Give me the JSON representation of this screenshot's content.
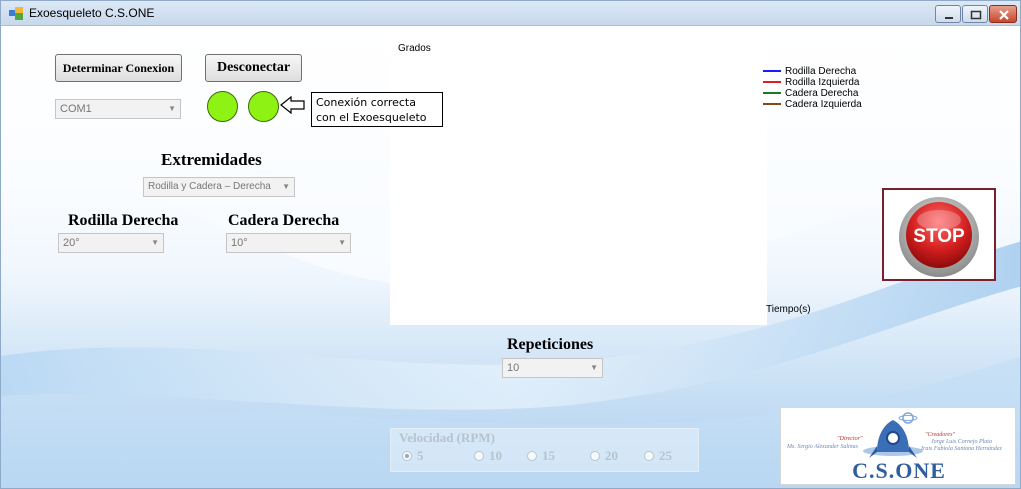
{
  "window": {
    "title": "Exoesqueleto  C.S.ONE"
  },
  "connection": {
    "determine_label": "Determinar Conexion",
    "disconnect_label": "Desconectar",
    "port_value": "COM1",
    "status_message": "Conexión correcta con el Exoesqueleto"
  },
  "extremities": {
    "title": "Extremidades",
    "selected": "Rodilla y Cadera – Derecha"
  },
  "knee": {
    "title": "Rodilla Derecha",
    "value": "20°"
  },
  "hip": {
    "title": "Cadera Derecha",
    "value": "10°"
  },
  "chart": {
    "ylabel": "Grados",
    "xlabel": "Tiempo(s)",
    "legend": [
      {
        "name": "Rodilla Derecha",
        "color": "#1a1aff"
      },
      {
        "name": "Rodilla Izquierda",
        "color": "#e81b1b"
      },
      {
        "name": "Cadera Derecha",
        "color": "#1f7a1f"
      },
      {
        "name": "Cadera Izquierda",
        "color": "#8b4513"
      }
    ]
  },
  "stop_button": {
    "label": "STOP",
    "color": "#d31f1f"
  },
  "repetitions": {
    "title": "Repeticiones",
    "value": "10"
  },
  "speed": {
    "title": "Velocidad (RPM)",
    "options": [
      "5",
      "10",
      "15",
      "20",
      "25"
    ],
    "selected": "5"
  },
  "logo": {
    "director_title": "\"Director\"",
    "director_name": "Ms. Sergio Alexander Salinas",
    "creators_title": "\"Creadores\"",
    "creator_1": "Jorge Luis Cornejo Plata",
    "creator_2": "Irais Fabiola Santana Hernández",
    "brand": "C.S.ONE"
  }
}
